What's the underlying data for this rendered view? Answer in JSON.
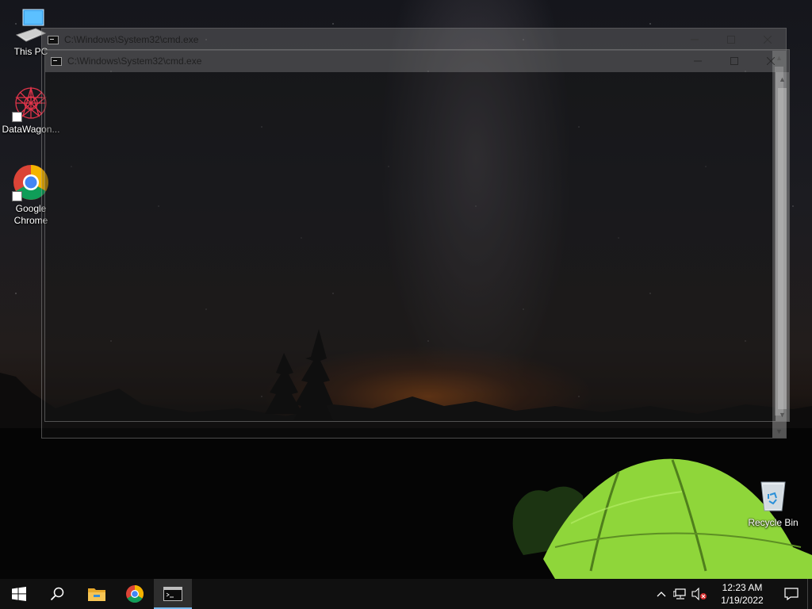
{
  "desktop": {
    "icons": [
      {
        "label": "This PC",
        "icon": "this-pc-icon"
      },
      {
        "label": "DataWagon...",
        "icon": "datawagon-icon"
      },
      {
        "label": "Google Chrome",
        "icon": "chrome-icon"
      },
      {
        "label": "Recycle Bin",
        "icon": "recycle-bin-icon"
      }
    ]
  },
  "windows": [
    {
      "title": "C:\\Windows\\System32\\cmd.exe",
      "app": "Command Prompt"
    },
    {
      "title": "C:\\Windows\\System32\\cmd.exe",
      "app": "Command Prompt"
    }
  ],
  "taskbar": {
    "start": "windows-start-icon",
    "search": "search-icon",
    "pinned": [
      "file-explorer-icon",
      "chrome-icon",
      "cmd-icon"
    ],
    "active": "cmd-icon",
    "tray": {
      "icons": [
        "chevron-up-icon",
        "network-icon",
        "volume-muted-icon"
      ],
      "time": "12:23 AM",
      "date": "1/19/2022",
      "notifications": "action-center-icon"
    }
  },
  "colors": {
    "taskbar_bg": "#101010",
    "accent": "#76b9ed",
    "tent_green": "#8fd63a"
  }
}
